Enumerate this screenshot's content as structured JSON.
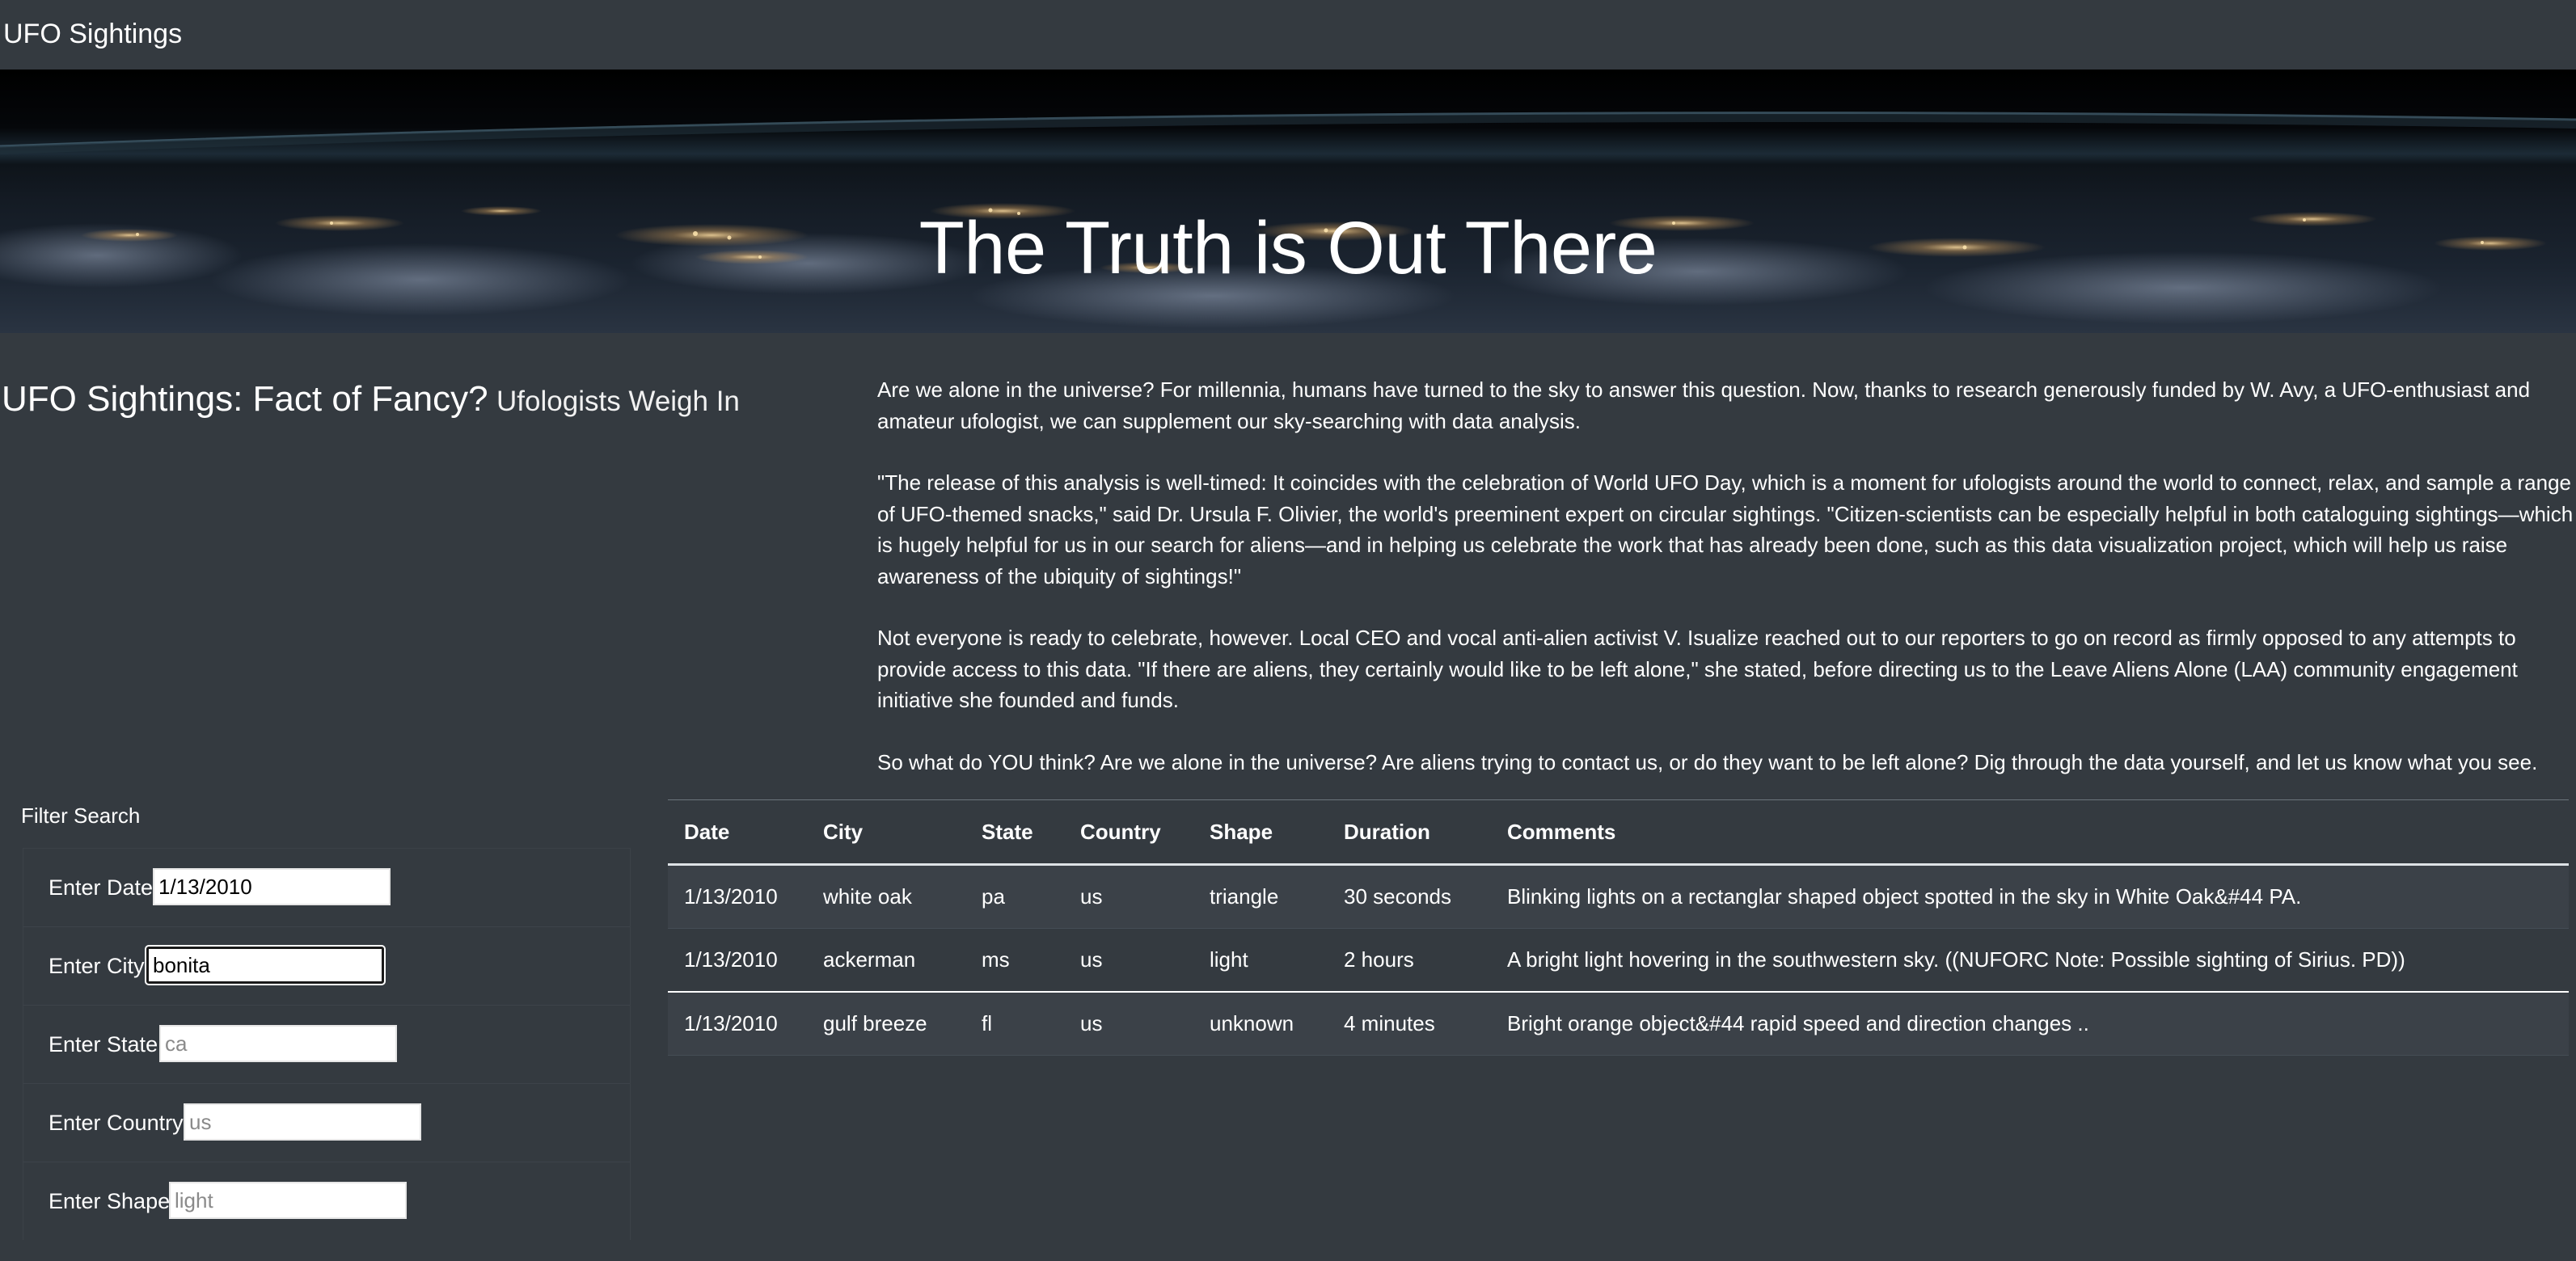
{
  "navbar": {
    "brand": "UFO Sightings"
  },
  "hero": {
    "title": "The Truth is Out There"
  },
  "article": {
    "title": "UFO Sightings: Fact of Fancy?",
    "subtitle": "Ufologists Weigh In",
    "paragraphs": [
      "Are we alone in the universe? For millennia, humans have turned to the sky to answer this question. Now, thanks to research generously funded by W. Avy, a UFO-enthusiast and amateur ufologist, we can supplement our sky-searching with data analysis.",
      "\"The release of this analysis is well-timed: It coincides with the celebration of World UFO Day, which is a moment for ufologists around the world to connect, relax, and sample a range of UFO-themed snacks,\" said Dr. Ursula F. Olivier, the world's preeminent expert on circular sightings. \"Citizen-scientists can be especially helpful in both cataloguing sightings—which is hugely helpful for us in our search for aliens—and in helping us celebrate the work that has already been done, such as this data visualization project, which will help us raise awareness of the ubiquity of sightings!\"",
      "Not everyone is ready to celebrate, however. Local CEO and vocal anti-alien activist V. Isualize reached out to our reporters to go on record as firmly opposed to any attempts to provide access to this data. \"If there are aliens, they certainly would like to be left alone,\" she stated, before directing us to the Leave Aliens Alone (LAA) community engagement initiative she founded and funds.",
      "So what do YOU think? Are we alone in the universe? Are aliens trying to contact us, or do they want to be left alone? Dig through the data yourself, and let us know what you see."
    ]
  },
  "filters": {
    "heading": "Filter Search",
    "date": {
      "label": "Enter Date",
      "value": "1/13/2010",
      "placeholder": ""
    },
    "city": {
      "label": "Enter City",
      "value": "bonita",
      "placeholder": ""
    },
    "state": {
      "label": "Enter State",
      "value": "",
      "placeholder": "ca"
    },
    "country": {
      "label": "Enter Country",
      "value": "",
      "placeholder": "us"
    },
    "shape": {
      "label": "Enter Shape",
      "value": "",
      "placeholder": "light"
    }
  },
  "table": {
    "headers": [
      "Date",
      "City",
      "State",
      "Country",
      "Shape",
      "Duration",
      "Comments"
    ],
    "rows": [
      [
        "1/13/2010",
        "white oak",
        "pa",
        "us",
        "triangle",
        "30 seconds",
        "Blinking lights on a rectanglar shaped object spotted in the sky in White Oak&#44 PA."
      ],
      [
        "1/13/2010",
        "ackerman",
        "ms",
        "us",
        "light",
        "2 hours",
        "A bright light hovering in the southwestern sky. ((NUFORC Note: Possible sighting of Sirius. PD))"
      ],
      [
        "1/13/2010",
        "gulf breeze",
        "fl",
        "us",
        "unknown",
        "4 minutes",
        "Bright orange object&#44 rapid speed and direction changes .."
      ]
    ]
  }
}
